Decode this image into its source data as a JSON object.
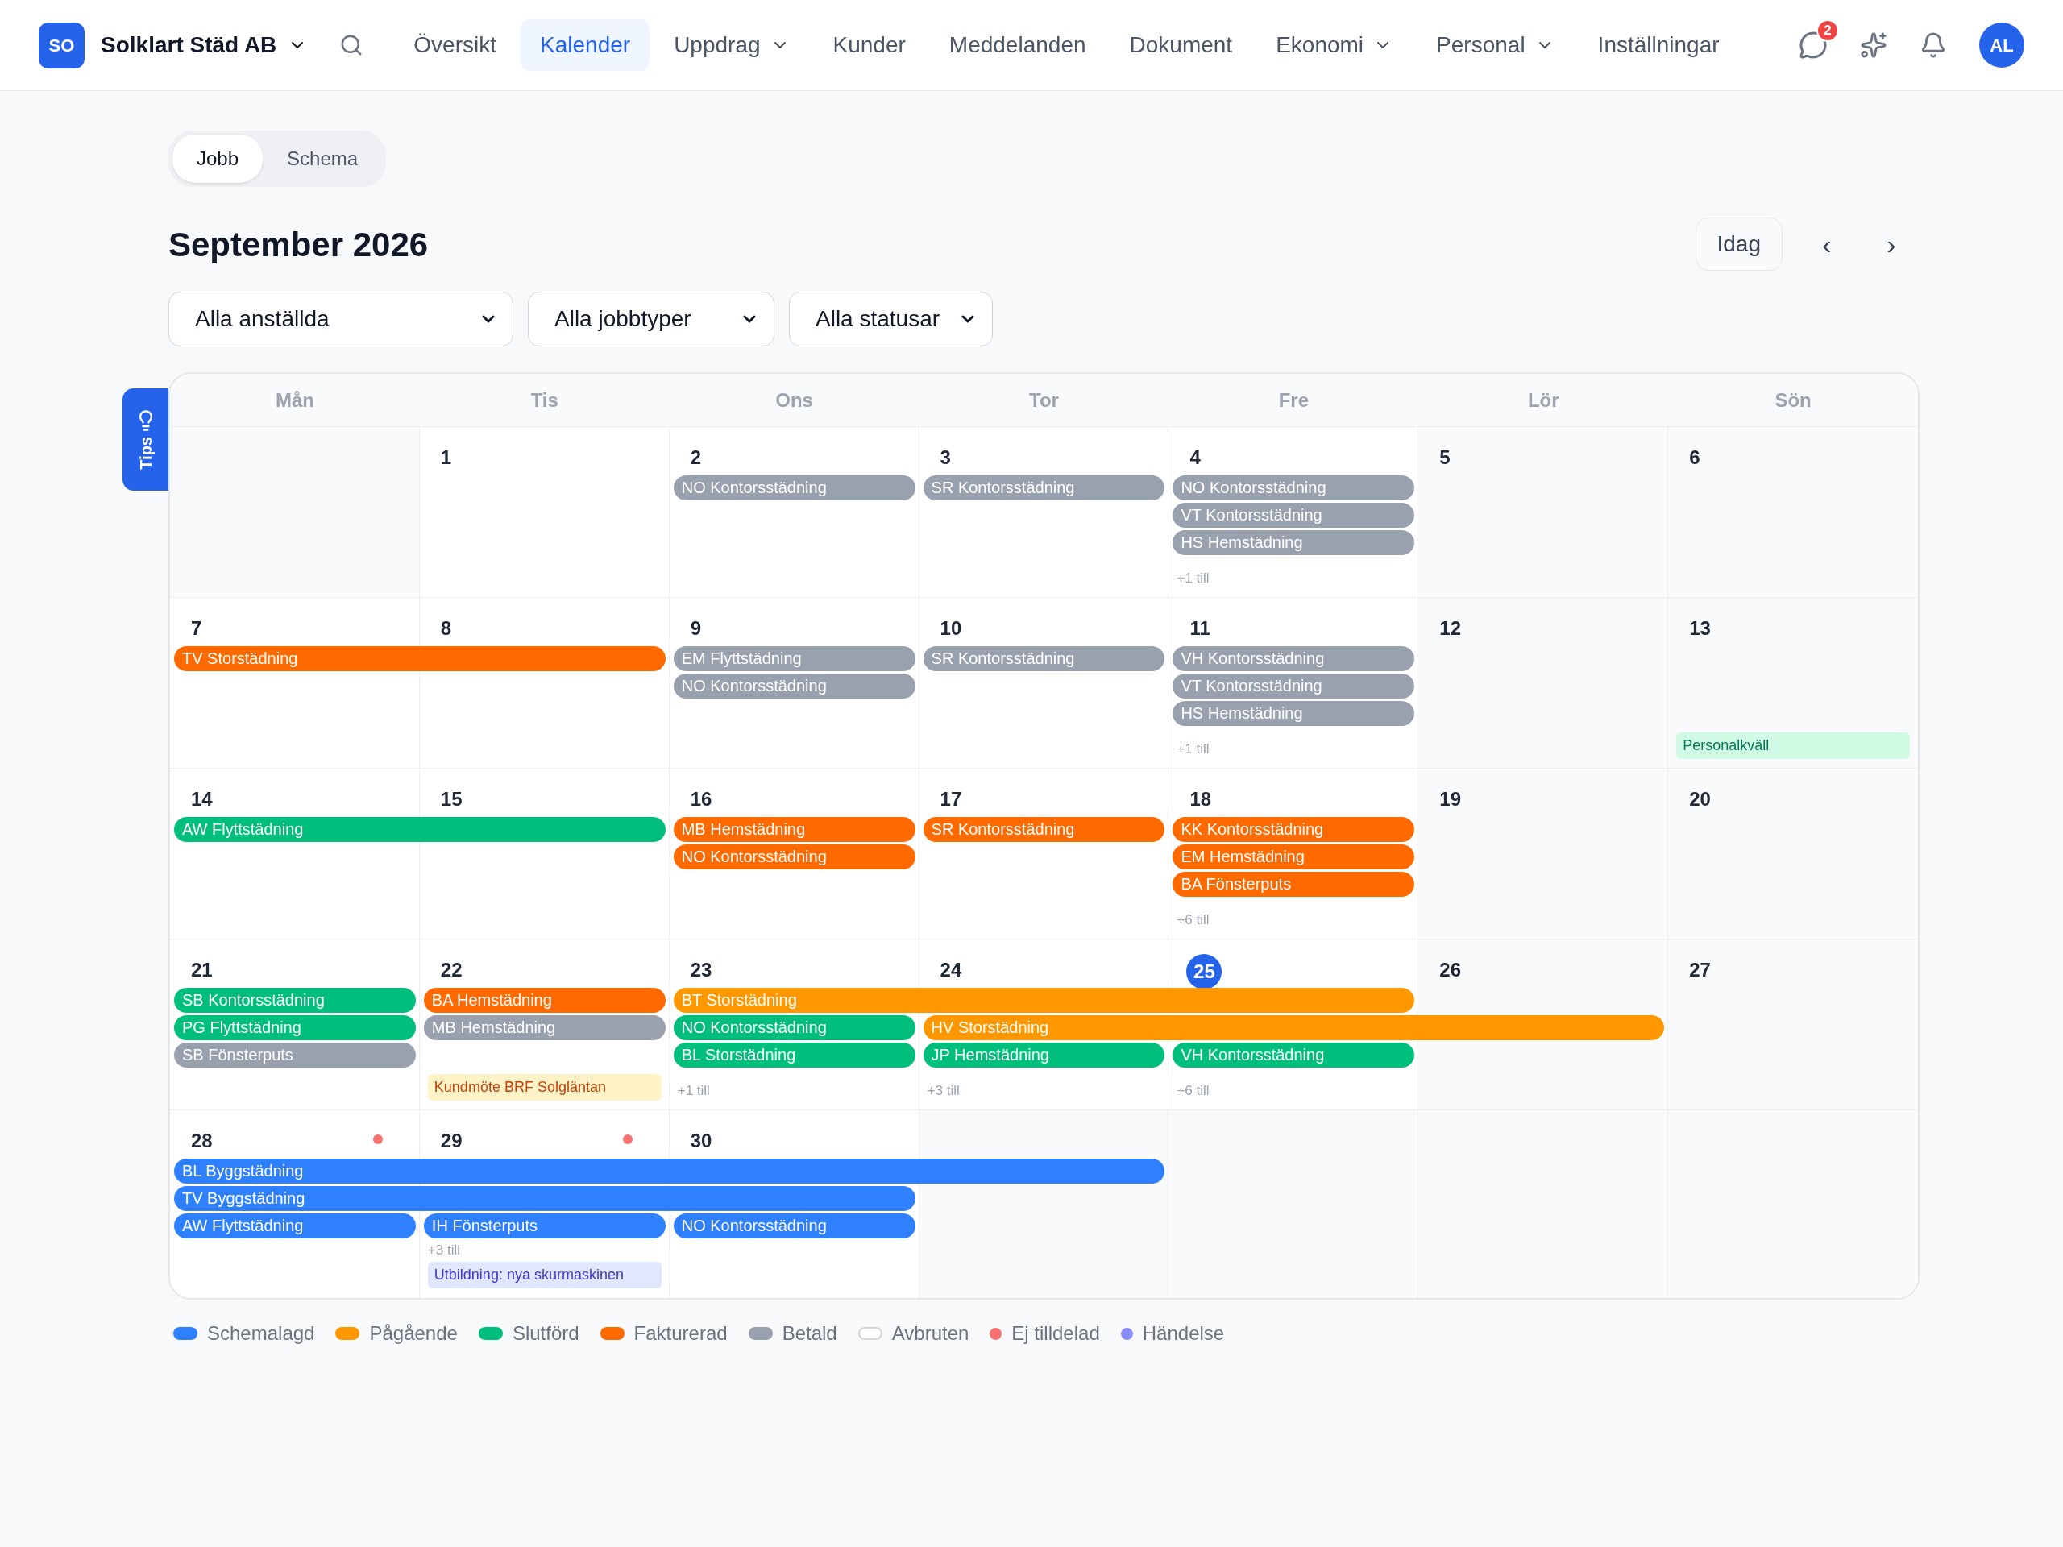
{
  "nav": {
    "logo": "SO",
    "company": "Solklart Städ AB",
    "items": [
      {
        "label": "Översikt",
        "selected": false,
        "menu": false
      },
      {
        "label": "Kalender",
        "selected": true,
        "menu": false
      },
      {
        "label": "Uppdrag",
        "selected": false,
        "menu": true
      },
      {
        "label": "Kunder",
        "selected": false,
        "menu": false
      },
      {
        "label": "Meddelanden",
        "selected": false,
        "menu": false
      },
      {
        "label": "Dokument",
        "selected": false,
        "menu": false
      },
      {
        "label": "Ekonomi",
        "selected": false,
        "menu": true
      },
      {
        "label": "Personal",
        "selected": false,
        "menu": true
      },
      {
        "label": "Inställningar",
        "selected": false,
        "menu": false
      }
    ],
    "message_count": "2",
    "avatar": "AL"
  },
  "tips": "Tips",
  "view_tabs": [
    {
      "label": "Jobb",
      "selected": true
    },
    {
      "label": "Schema",
      "selected": false
    }
  ],
  "title": "September 2026",
  "today_button": "Idag",
  "prev": "‹",
  "next": "›",
  "filters": [
    {
      "value": "Alla anställda"
    },
    {
      "value": "Alla jobbtyper"
    },
    {
      "value": "Alla statusar"
    }
  ],
  "weekdays": [
    "Mån",
    "Tis",
    "Ons",
    "Tor",
    "Fre",
    "Lör",
    "Sön"
  ],
  "weeks": [
    {
      "days": [
        {
          "kind": "blank"
        },
        {
          "kind": "day",
          "label": "1"
        },
        {
          "kind": "day",
          "label": "2",
          "events": [
            {
              "kind": "job",
              "text": "NO Kontorsstädning",
              "color": "#9aa1ae"
            }
          ]
        },
        {
          "kind": "day",
          "label": "3",
          "events": [
            {
              "kind": "job",
              "text": "SR Kontorsstädning",
              "color": "#9aa1ae"
            }
          ]
        },
        {
          "kind": "day",
          "label": "4",
          "events": [
            {
              "kind": "job",
              "text": "NO Kontorsstädning",
              "color": "#9aa1ae"
            },
            {
              "kind": "job",
              "text": "VT Kontorsstädning",
              "color": "#9aa1ae"
            },
            {
              "kind": "job",
              "text": "HS Hemstädning",
              "color": "#9aa1ae"
            }
          ],
          "more": "+1 till"
        },
        {
          "kind": "day",
          "label": "5"
        },
        {
          "kind": "day",
          "label": "6"
        }
      ]
    },
    {
      "days": [
        {
          "kind": "day",
          "label": "7",
          "events": [
            {
              "kind": "job",
              "text": "TV Storstädning",
              "color": "#ff6a00",
              "continues": true
            }
          ]
        },
        {
          "kind": "day",
          "label": "8",
          "events": [
            {
              "kind": "continued"
            }
          ]
        },
        {
          "kind": "day",
          "label": "9",
          "events": [
            {
              "kind": "job",
              "text": "EM Flyttstädning",
              "color": "#9aa1ae"
            },
            {
              "kind": "job",
              "text": "NO Kontorsstädning",
              "color": "#9aa1ae"
            }
          ]
        },
        {
          "kind": "day",
          "label": "10",
          "events": [
            {
              "kind": "job",
              "text": "SR Kontorsstädning",
              "color": "#9aa1ae"
            }
          ]
        },
        {
          "kind": "day",
          "label": "11",
          "events": [
            {
              "kind": "job",
              "text": "VH Kontorsstädning",
              "color": "#9aa1ae"
            },
            {
              "kind": "job",
              "text": "VT Kontorsstädning",
              "color": "#9aa1ae"
            },
            {
              "kind": "job",
              "text": "HS Hemstädning",
              "color": "#9aa1ae"
            }
          ],
          "more": "+1 till"
        },
        {
          "kind": "day",
          "label": "12"
        },
        {
          "kind": "day",
          "label": "13",
          "note": {
            "text": "Personalkväll",
            "kind": "social"
          }
        }
      ]
    },
    {
      "days": [
        {
          "kind": "day",
          "label": "14",
          "events": [
            {
              "kind": "job",
              "text": "AW Flyttstädning",
              "color": "#00bf7d",
              "continues": true
            }
          ]
        },
        {
          "kind": "day",
          "label": "15",
          "events": [
            {
              "kind": "continued"
            }
          ]
        },
        {
          "kind": "day",
          "label": "16",
          "events": [
            {
              "kind": "job",
              "text": "MB Hemstädning",
              "color": "#ff6a00"
            },
            {
              "kind": "job",
              "text": "NO Kontorsstädning",
              "color": "#ff6a00"
            }
          ]
        },
        {
          "kind": "day",
          "label": "17",
          "events": [
            {
              "kind": "job",
              "text": "SR Kontorsstädning",
              "color": "#ff6a00"
            }
          ]
        },
        {
          "kind": "day",
          "label": "18",
          "events": [
            {
              "kind": "job",
              "text": "KK Kontorsstädning",
              "color": "#ff6a00"
            },
            {
              "kind": "job",
              "text": "EM Hemstädning",
              "color": "#ff6a00"
            },
            {
              "kind": "job",
              "text": "BA Fönsterputs",
              "color": "#ff6a00"
            }
          ],
          "more": "+6 till"
        },
        {
          "kind": "day",
          "label": "19"
        },
        {
          "kind": "day",
          "label": "20"
        }
      ]
    },
    {
      "days": [
        {
          "kind": "day",
          "label": "21",
          "events": [
            {
              "kind": "job",
              "text": "SB Kontorsstädning",
              "color": "#00bf7d"
            },
            {
              "kind": "job",
              "text": "PG Flyttstädning",
              "color": "#00bf7d"
            },
            {
              "kind": "job",
              "text": "SB Fönsterputs",
              "color": "#9aa1ae"
            }
          ]
        },
        {
          "kind": "day",
          "label": "22",
          "events": [
            {
              "kind": "job",
              "text": "BA Hemstädning",
              "color": "#ff6a00"
            },
            {
              "kind": "job",
              "text": "MB Hemstädning",
              "color": "#9aa1ae"
            }
          ],
          "note": {
            "text": "Kundmöte BRF Solgläntan",
            "kind": "meeting"
          }
        },
        {
          "kind": "day",
          "label": "23",
          "events": [
            {
              "kind": "job",
              "text": "BT Storstädning",
              "color": "#ff9800",
              "continues": true
            },
            {
              "kind": "job",
              "text": "NO Kontorsstädning",
              "color": "#00bf7d"
            },
            {
              "kind": "job",
              "text": "BL Storstädning",
              "color": "#00bf7d"
            }
          ],
          "more": "+1 till"
        },
        {
          "kind": "day",
          "label": "24",
          "events": [
            {
              "kind": "continued",
              "continues": true
            },
            {
              "kind": "job",
              "text": "HV Storstädning",
              "color": "#ff9800",
              "continues": true
            },
            {
              "kind": "job",
              "text": "JP Hemstädning",
              "color": "#00bf7d"
            }
          ],
          "more": "+3 till"
        },
        {
          "kind": "day",
          "label": "25",
          "today": true,
          "events": [
            {
              "kind": "continued"
            },
            {
              "kind": "continued",
              "continues": true
            },
            {
              "kind": "job",
              "text": "VH Kontorsstädning",
              "color": "#00bf7d"
            }
          ],
          "more": "+6 till"
        },
        {
          "kind": "day",
          "label": "26",
          "events": [
            {
              "kind": "continued"
            }
          ]
        },
        {
          "kind": "day",
          "label": "27"
        }
      ]
    },
    {
      "days": [
        {
          "kind": "day",
          "label": "28",
          "unassigned": true,
          "events": [
            {
              "kind": "job",
              "text": "BL Byggstädning",
              "color": "#2f80ff",
              "continues": true
            },
            {
              "kind": "job",
              "text": "TV Byggstädning",
              "color": "#2f80ff",
              "continues": true
            },
            {
              "kind": "job",
              "text": "AW Flyttstädning",
              "color": "#2f80ff"
            }
          ]
        },
        {
          "kind": "day",
          "label": "29",
          "unassigned": true,
          "events": [
            {
              "kind": "continued",
              "continues": true
            },
            {
              "kind": "continued",
              "continues": true
            },
            {
              "kind": "job",
              "text": "IH Fönsterputs",
              "color": "#2f80ff"
            }
          ],
          "more": "+3 till",
          "note": {
            "text": "Utbildning: nya skurmaskinen",
            "kind": "training"
          }
        },
        {
          "kind": "day",
          "label": "30",
          "events": [
            {
              "kind": "continued",
              "continues": true
            },
            {
              "kind": "continued"
            },
            {
              "kind": "job",
              "text": "NO Kontorsstädning",
              "color": "#2f80ff"
            }
          ]
        },
        {
          "kind": "blank",
          "events": [
            {
              "kind": "continued"
            }
          ]
        },
        {
          "kind": "blank"
        },
        {
          "kind": "blank"
        },
        {
          "kind": "blank"
        }
      ]
    }
  ],
  "legend": [
    {
      "label": "Schemalagd",
      "kind": "pill",
      "color": "#2f80ff"
    },
    {
      "label": "Pågående",
      "kind": "pill",
      "color": "#ff9800"
    },
    {
      "label": "Slutförd",
      "kind": "pill",
      "color": "#00bf7d"
    },
    {
      "label": "Fakturerad",
      "kind": "pill",
      "color": "#ff6a00"
    },
    {
      "label": "Betald",
      "kind": "pill",
      "color": "#9aa1ae"
    },
    {
      "label": "Avbruten",
      "kind": "outline",
      "color": "#d1d5db"
    },
    {
      "label": "Ej tilldelad",
      "kind": "dot",
      "color": "#f87171"
    },
    {
      "label": "Händelse",
      "kind": "dot",
      "color": "#8b8cf8"
    }
  ]
}
